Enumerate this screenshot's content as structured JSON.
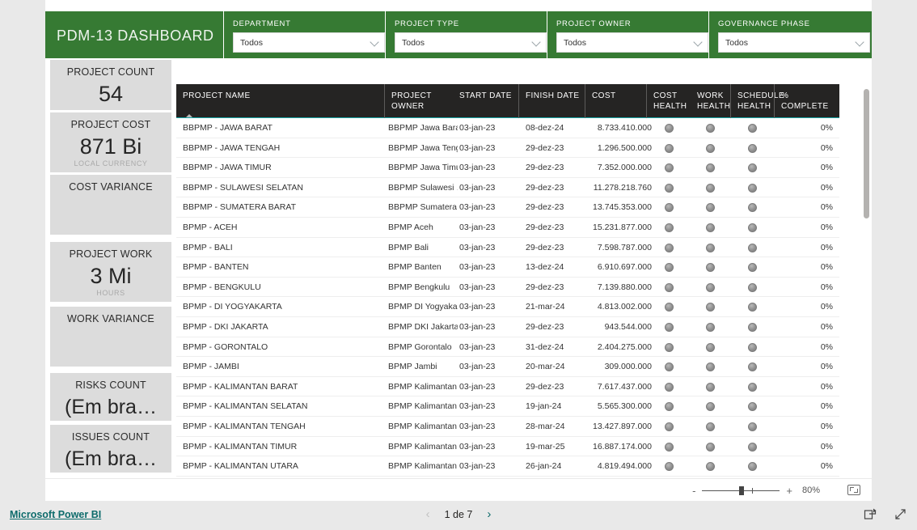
{
  "header": {
    "title": "PDM-13 DASHBOARD",
    "brand_color": "#367a33",
    "slicers": [
      {
        "label": "DEPARTMENT",
        "value": "Todos",
        "icon": "chevron-down-icon"
      },
      {
        "label": "PROJECT TYPE",
        "value": "Todos",
        "icon": "chevron-down-icon"
      },
      {
        "label": "PROJECT OWNER",
        "value": "Todos",
        "icon": "chevron-down-icon"
      },
      {
        "label": "GOVERNANCE PHASE",
        "value": "Todos",
        "icon": "chevron-down-icon"
      }
    ]
  },
  "kpis": [
    {
      "title": "PROJECT COUNT",
      "value": "54",
      "unit": ""
    },
    {
      "title": "PROJECT COST",
      "value": "871 Bi",
      "unit": "LOCAL CURRENCY"
    },
    {
      "title": "COST VARIANCE",
      "value": "",
      "unit": ""
    },
    {
      "title": "PROJECT WORK",
      "value": "3 Mi",
      "unit": "HOURS"
    },
    {
      "title": "WORK VARIANCE",
      "value": "",
      "unit": ""
    },
    {
      "title": "RISKS COUNT",
      "value": "(Em bra…",
      "unit": ""
    },
    {
      "title": "ISSUES COUNT",
      "value": "(Em bra…",
      "unit": ""
    }
  ],
  "table": {
    "sort_column": "PROJECT NAME",
    "sort_direction": "ascending",
    "columns": [
      "PROJECT NAME",
      "PROJECT OWNER",
      "START DATE",
      "FINISH DATE",
      "COST",
      "COST HEALTH",
      "WORK HEALTH",
      "SCHEDULE HEALTH",
      "% COMPLETE"
    ],
    "rows": [
      {
        "name": "BBPMP - JAWA BARAT",
        "owner": "BBPMP Jawa Barat",
        "start": "03-jan-23",
        "finish": "08-dez-24",
        "cost": "8.733.410.000",
        "cost_health": "gray",
        "work_health": "gray",
        "schedule_health": "gray",
        "complete": "0%"
      },
      {
        "name": "BBPMP - JAWA TENGAH",
        "owner": "BBPMP Jawa Teng…",
        "start": "03-jan-23",
        "finish": "29-dez-23",
        "cost": "1.296.500.000",
        "cost_health": "gray",
        "work_health": "gray",
        "schedule_health": "gray",
        "complete": "0%"
      },
      {
        "name": "BBPMP - JAWA TIMUR",
        "owner": "BBPMP Jawa Timur",
        "start": "03-jan-23",
        "finish": "29-dez-23",
        "cost": "7.352.000.000",
        "cost_health": "gray",
        "work_health": "gray",
        "schedule_health": "gray",
        "complete": "0%"
      },
      {
        "name": "BBPMP - SULAWESI SELATAN",
        "owner": "BBPMP Sulawesi …",
        "start": "03-jan-23",
        "finish": "29-dez-23",
        "cost": "11.278.218.760",
        "cost_health": "gray",
        "work_health": "gray",
        "schedule_health": "gray",
        "complete": "0%"
      },
      {
        "name": "BBPMP - SUMATERA BARAT",
        "owner": "BBPMP Sumatera …",
        "start": "03-jan-23",
        "finish": "29-dez-23",
        "cost": "13.745.353.000",
        "cost_health": "gray",
        "work_health": "gray",
        "schedule_health": "gray",
        "complete": "0%"
      },
      {
        "name": "BPMP - ACEH",
        "owner": "BPMP Aceh",
        "start": "03-jan-23",
        "finish": "29-dez-23",
        "cost": "15.231.877.000",
        "cost_health": "gray",
        "work_health": "gray",
        "schedule_health": "gray",
        "complete": "0%"
      },
      {
        "name": "BPMP - BALI",
        "owner": "BPMP Bali",
        "start": "03-jan-23",
        "finish": "29-dez-23",
        "cost": "7.598.787.000",
        "cost_health": "gray",
        "work_health": "gray",
        "schedule_health": "gray",
        "complete": "0%"
      },
      {
        "name": "BPMP - BANTEN",
        "owner": "BPMP Banten",
        "start": "03-jan-23",
        "finish": "13-dez-24",
        "cost": "6.910.697.000",
        "cost_health": "gray",
        "work_health": "gray",
        "schedule_health": "gray",
        "complete": "0%"
      },
      {
        "name": "BPMP - BENGKULU",
        "owner": "BPMP Bengkulu",
        "start": "03-jan-23",
        "finish": "29-dez-23",
        "cost": "7.139.880.000",
        "cost_health": "gray",
        "work_health": "gray",
        "schedule_health": "gray",
        "complete": "0%"
      },
      {
        "name": "BPMP - DI YOGYAKARTA",
        "owner": "BPMP DI Yogyaka…",
        "start": "03-jan-23",
        "finish": "21-mar-24",
        "cost": "4.813.002.000",
        "cost_health": "gray",
        "work_health": "gray",
        "schedule_health": "gray",
        "complete": "0%"
      },
      {
        "name": "BPMP - DKI JAKARTA",
        "owner": "BPMP DKI Jakarta",
        "start": "03-jan-23",
        "finish": "29-dez-23",
        "cost": "943.544.000",
        "cost_health": "gray",
        "work_health": "gray",
        "schedule_health": "gray",
        "complete": "0%"
      },
      {
        "name": "BPMP - GORONTALO",
        "owner": "BPMP Gorontalo",
        "start": "03-jan-23",
        "finish": "31-dez-24",
        "cost": "2.404.275.000",
        "cost_health": "gray",
        "work_health": "gray",
        "schedule_health": "gray",
        "complete": "0%"
      },
      {
        "name": "BPMP - JAMBI",
        "owner": "BPMP Jambi",
        "start": "03-jan-23",
        "finish": "20-mar-24",
        "cost": "309.000.000",
        "cost_health": "gray",
        "work_health": "gray",
        "schedule_health": "gray",
        "complete": "0%"
      },
      {
        "name": "BPMP - KALIMANTAN BARAT",
        "owner": "BPMP Kalimantan…",
        "start": "03-jan-23",
        "finish": "29-dez-23",
        "cost": "7.617.437.000",
        "cost_health": "gray",
        "work_health": "gray",
        "schedule_health": "gray",
        "complete": "0%"
      },
      {
        "name": "BPMP - KALIMANTAN SELATAN",
        "owner": "BPMP Kalimantan…",
        "start": "03-jan-23",
        "finish": "19-jan-24",
        "cost": "5.565.300.000",
        "cost_health": "gray",
        "work_health": "gray",
        "schedule_health": "gray",
        "complete": "0%"
      },
      {
        "name": "BPMP - KALIMANTAN TENGAH",
        "owner": "BPMP Kalimantan…",
        "start": "03-jan-23",
        "finish": "28-mar-24",
        "cost": "13.427.897.000",
        "cost_health": "gray",
        "work_health": "gray",
        "schedule_health": "gray",
        "complete": "0%"
      },
      {
        "name": "BPMP - KALIMANTAN TIMUR",
        "owner": "BPMP Kalimantan…",
        "start": "03-jan-23",
        "finish": "19-mar-25",
        "cost": "16.887.174.000",
        "cost_health": "gray",
        "work_health": "gray",
        "schedule_health": "gray",
        "complete": "0%"
      },
      {
        "name": "BPMP - KALIMANTAN UTARA",
        "owner": "BPMP Kalimantan…",
        "start": "03-jan-23",
        "finish": "26-jan-24",
        "cost": "4.819.494.000",
        "cost_health": "gray",
        "work_health": "gray",
        "schedule_health": "gray",
        "complete": "0%"
      }
    ]
  },
  "toolbar": {
    "zoom_out_label": "-",
    "zoom_in_label": "+",
    "zoom_level": "80%",
    "fit_icon": "fit-to-page-icon"
  },
  "footer": {
    "brand": "Microsoft Power BI",
    "prev_label": "‹",
    "next_label": "›",
    "page_text": "1 de 7",
    "share_icon": "share-icon",
    "fullscreen_icon": "fullscreen-icon",
    "link_color": "#0d6b6b"
  }
}
